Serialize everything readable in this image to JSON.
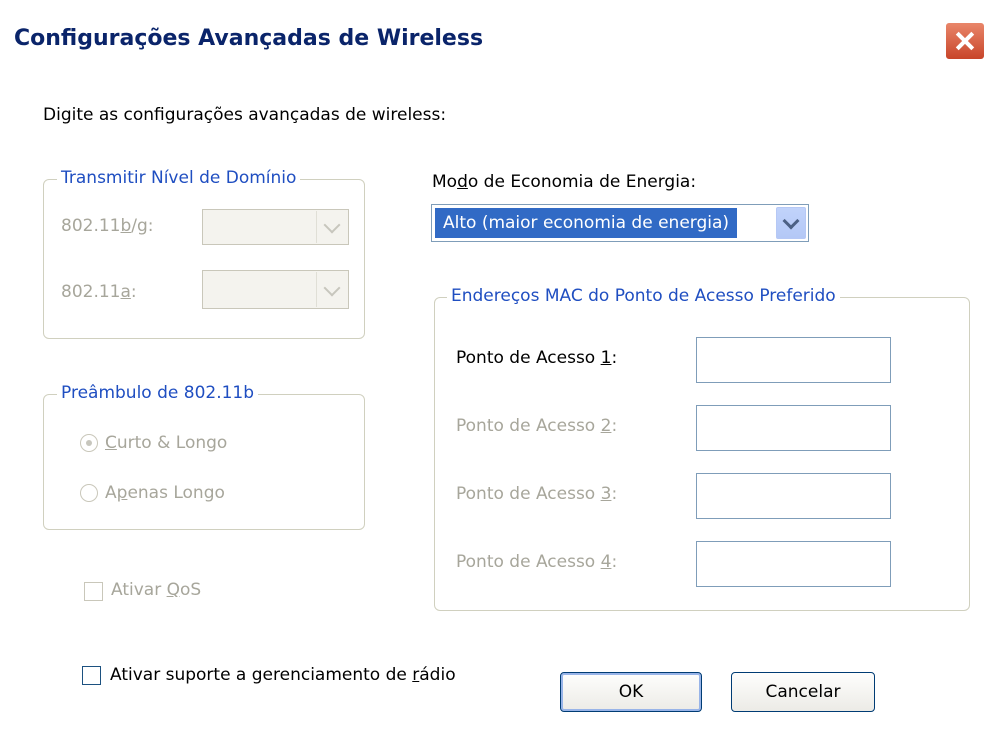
{
  "window": {
    "title": "Configurações Avançadas de Wireless"
  },
  "instruction": "Digite as configurações avançadas de wireless:",
  "domain_group": {
    "legend": "Transmitir Nível de Domínio",
    "bg_label_pre": "802.11",
    "bg_label_u": "b",
    "bg_label_post": "/g:",
    "a_label_pre": "802.11",
    "a_label_u": "a",
    "a_label_post": ":",
    "bg_value": "",
    "a_value": ""
  },
  "preamble_group": {
    "legend": "Preâmbulo de 802.11b",
    "opt1_u": "C",
    "opt1_rest": "urto & Longo",
    "opt2_pre": "A",
    "opt2_u": "p",
    "opt2_rest": "enas Longo"
  },
  "qos": {
    "pre": "Ativar ",
    "u": "Q",
    "post": "oS"
  },
  "power": {
    "label_pre": "Mo",
    "label_u": "d",
    "label_post": "o de Economia de Energia:",
    "value": "Alto (maior economia de energia)"
  },
  "mac_group": {
    "legend": "Endereços MAC do Ponto de Acesso Preferido",
    "ap1_pre": "Ponto de Acesso ",
    "ap1_u": "1",
    "ap1_post": ":",
    "ap2_pre": "Ponto de Acesso ",
    "ap2_u": "2",
    "ap2_post": ":",
    "ap3_pre": "Ponto de Acesso ",
    "ap3_u": "3",
    "ap3_post": ":",
    "ap4_pre": "Ponto de Acesso ",
    "ap4_u": "4",
    "ap4_post": ":",
    "ap1_value": "",
    "ap2_value": "",
    "ap3_value": "",
    "ap4_value": ""
  },
  "radio_mgmt": {
    "pre": "Ativar suporte a gerenciamento de ",
    "u": "r",
    "post": "ádio"
  },
  "buttons": {
    "ok": "OK",
    "cancel": "Cancelar"
  },
  "colors": {
    "title_text": "#0a246a",
    "group_legend": "#1f4ec1",
    "selection": "#316ac5",
    "disabled_text": "#a7a69b"
  },
  "icons": {
    "close": "close-icon",
    "dropdown": "chevron-down-icon"
  }
}
